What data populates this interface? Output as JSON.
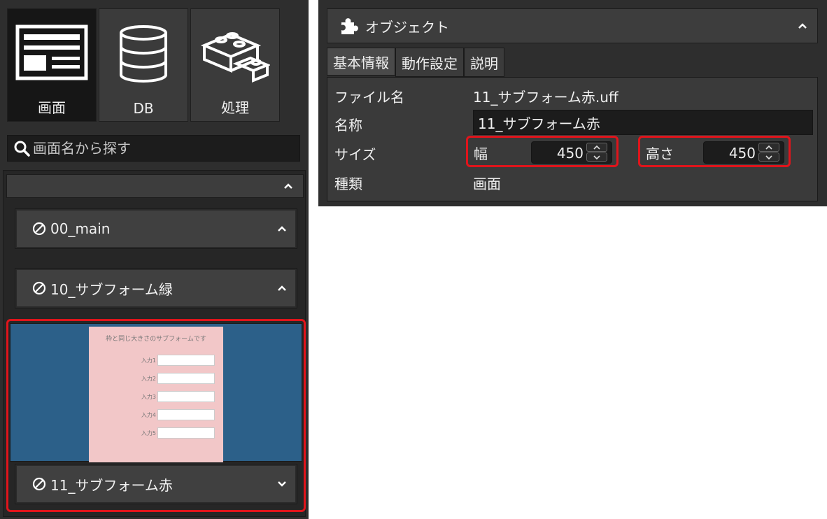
{
  "left_panel": {
    "modes": [
      {
        "label": "画面",
        "icon": "screen-icon",
        "active": true
      },
      {
        "label": "DB",
        "icon": "database-icon",
        "active": false
      },
      {
        "label": "処理",
        "icon": "blocks-icon",
        "active": false
      }
    ],
    "search": {
      "placeholder": "画面名から探す",
      "icon": "search-icon"
    },
    "forms": [
      {
        "name": "00_main",
        "expanded": false
      },
      {
        "name": "10_サブフォーム緑",
        "expanded": false
      },
      {
        "name": "11_サブフォーム赤",
        "expanded": true,
        "selected": true
      }
    ],
    "preview": {
      "title": "枠と同じ大きさのサブフォームです",
      "fields": [
        "入力1",
        "入力2",
        "入力3",
        "入力4",
        "入力5"
      ]
    }
  },
  "object_panel": {
    "title": "オブジェクト",
    "tabs": [
      {
        "label": "基本情報",
        "active": true
      },
      {
        "label": "動作設定",
        "active": false
      },
      {
        "label": "説明",
        "active": false
      }
    ],
    "properties": {
      "file_label": "ファイル名",
      "file_value": "11_サブフォーム赤.uff",
      "name_label": "名称",
      "name_value": "11_サブフォーム赤",
      "size_label": "サイズ",
      "width_label": "幅",
      "width_value": "450",
      "height_label": "高さ",
      "height_value": "450",
      "kind_label": "種類",
      "kind_value": "画面"
    }
  },
  "colors": {
    "panel_bg": "#2e2e2e",
    "highlight": "#e0141b",
    "preview_bg": "#2c6089",
    "form_bg": "#f2c7c8"
  }
}
